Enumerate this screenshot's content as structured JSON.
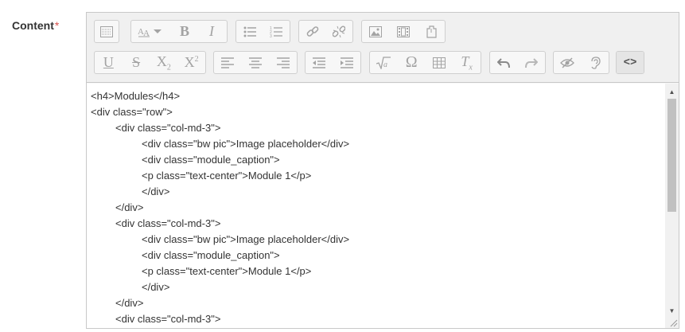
{
  "field": {
    "label": "Content",
    "required_mark": "*"
  },
  "toolbar": {
    "row1": [
      {
        "name": "toolbar-toggle-button",
        "icon": "toolbar-toggle-icon"
      },
      {
        "name": "font-size-button",
        "icon": "font-size-icon"
      },
      {
        "name": "bold-button",
        "icon": "bold-icon",
        "glyph": "B"
      },
      {
        "name": "italic-button",
        "icon": "italic-icon",
        "glyph": "I"
      },
      {
        "name": "unordered-list-button",
        "icon": "unordered-list-icon"
      },
      {
        "name": "ordered-list-button",
        "icon": "ordered-list-icon"
      },
      {
        "name": "link-button",
        "icon": "link-icon"
      },
      {
        "name": "unlink-button",
        "icon": "unlink-icon"
      },
      {
        "name": "insert-image-button",
        "icon": "image-icon"
      },
      {
        "name": "insert-media-button",
        "icon": "media-icon"
      },
      {
        "name": "manage-files-button",
        "icon": "files-icon"
      }
    ],
    "row2": [
      {
        "name": "underline-button",
        "icon": "underline-icon",
        "glyph": "U"
      },
      {
        "name": "strikethrough-button",
        "icon": "strikethrough-icon",
        "glyph": "S"
      },
      {
        "name": "subscript-button",
        "icon": "subscript-icon",
        "glyph": "X",
        "script": "2"
      },
      {
        "name": "superscript-button",
        "icon": "superscript-icon",
        "glyph": "X",
        "script": "2"
      },
      {
        "name": "align-left-button",
        "icon": "align-left-icon"
      },
      {
        "name": "align-center-button",
        "icon": "align-center-icon"
      },
      {
        "name": "align-right-button",
        "icon": "align-right-icon"
      },
      {
        "name": "outdent-button",
        "icon": "outdent-icon"
      },
      {
        "name": "indent-button",
        "icon": "indent-icon"
      },
      {
        "name": "equation-button",
        "icon": "equation-icon"
      },
      {
        "name": "special-character-button",
        "icon": "omega-icon",
        "glyph": "Ω"
      },
      {
        "name": "table-button",
        "icon": "table-icon"
      },
      {
        "name": "clear-formatting-button",
        "icon": "clear-formatting-icon",
        "glyph": "T",
        "script": "x"
      },
      {
        "name": "undo-button",
        "icon": "undo-icon"
      },
      {
        "name": "redo-button",
        "icon": "redo-icon"
      },
      {
        "name": "accessibility-checker-button",
        "icon": "eye-slash-icon"
      },
      {
        "name": "screenreader-helper-button",
        "icon": "ear-icon"
      },
      {
        "name": "html-source-button",
        "icon": "code-icon",
        "glyph": "<>"
      }
    ]
  },
  "editor": {
    "lines": [
      {
        "indent": 0,
        "text": "<h4>Modules</h4>"
      },
      {
        "indent": 0,
        "text": "<div class=\"row\">"
      },
      {
        "indent": 1,
        "text": "<div class=\"col-md-3\">"
      },
      {
        "indent": 2,
        "text": "<div class=\"bw pic\">Image placeholder</div>"
      },
      {
        "indent": 2,
        "text": "<div class=\"module_caption\">"
      },
      {
        "indent": 2,
        "text": "<p class=\"text-center\">Module 1</p>"
      },
      {
        "indent": 2,
        "text": "</div>"
      },
      {
        "indent": 1,
        "text": "</div>"
      },
      {
        "indent": 1,
        "text": "<div class=\"col-md-3\">"
      },
      {
        "indent": 2,
        "text": "<div class=\"bw pic\">Image placeholder</div>"
      },
      {
        "indent": 2,
        "text": "<div class=\"module_caption\">"
      },
      {
        "indent": 2,
        "text": "<p class=\"text-center\">Module 1</p>"
      },
      {
        "indent": 2,
        "text": "</div>"
      },
      {
        "indent": 1,
        "text": "</div>"
      },
      {
        "indent": 1,
        "text": "<div class=\"col-md-3\">"
      }
    ]
  },
  "colors": {
    "required": "#d9534f",
    "icon": "#a3a3a3",
    "border": "#c8c8c8"
  }
}
